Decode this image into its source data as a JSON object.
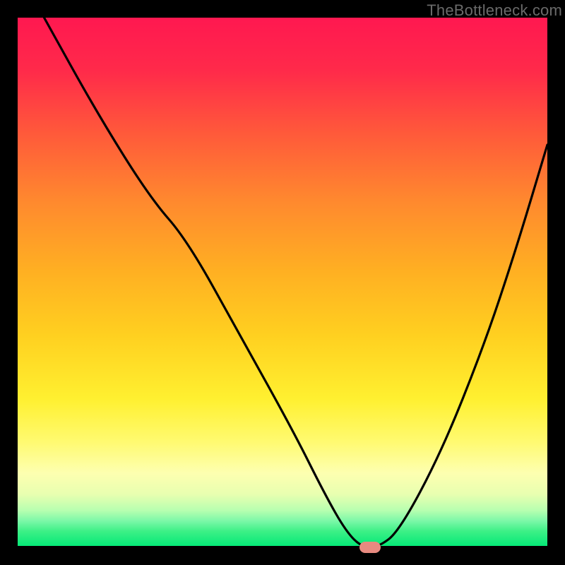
{
  "watermark": "TheBottleneck.com",
  "chart_data": {
    "type": "line",
    "title": "",
    "xlabel": "",
    "ylabel": "",
    "x_range": [
      0,
      100
    ],
    "y_range": [
      0,
      100
    ],
    "series": [
      {
        "name": "curve",
        "x": [
          5,
          15,
          25,
          32,
          42,
          52,
          58,
          62,
          65,
          68,
          72,
          80,
          88,
          94,
          100
        ],
        "y": [
          100,
          82,
          66,
          58,
          40,
          22,
          10,
          3,
          0,
          0,
          3,
          18,
          38,
          56,
          76
        ]
      }
    ],
    "marker": {
      "x": 66.5,
      "y": 0
    },
    "gradient_stops": [
      {
        "pos": 0,
        "color": "#ff1850"
      },
      {
        "pos": 10,
        "color": "#ff2a4a"
      },
      {
        "pos": 22,
        "color": "#ff5a3a"
      },
      {
        "pos": 35,
        "color": "#ff8a2e"
      },
      {
        "pos": 48,
        "color": "#ffb022"
      },
      {
        "pos": 60,
        "color": "#ffd020"
      },
      {
        "pos": 72,
        "color": "#fff030"
      },
      {
        "pos": 80,
        "color": "#fffa70"
      },
      {
        "pos": 86,
        "color": "#fdffb0"
      },
      {
        "pos": 90,
        "color": "#e8ffb0"
      },
      {
        "pos": 93,
        "color": "#b8ffb0"
      },
      {
        "pos": 95,
        "color": "#7cf8a8"
      },
      {
        "pos": 97,
        "color": "#3cf086"
      },
      {
        "pos": 100,
        "color": "#00e876"
      }
    ]
  }
}
